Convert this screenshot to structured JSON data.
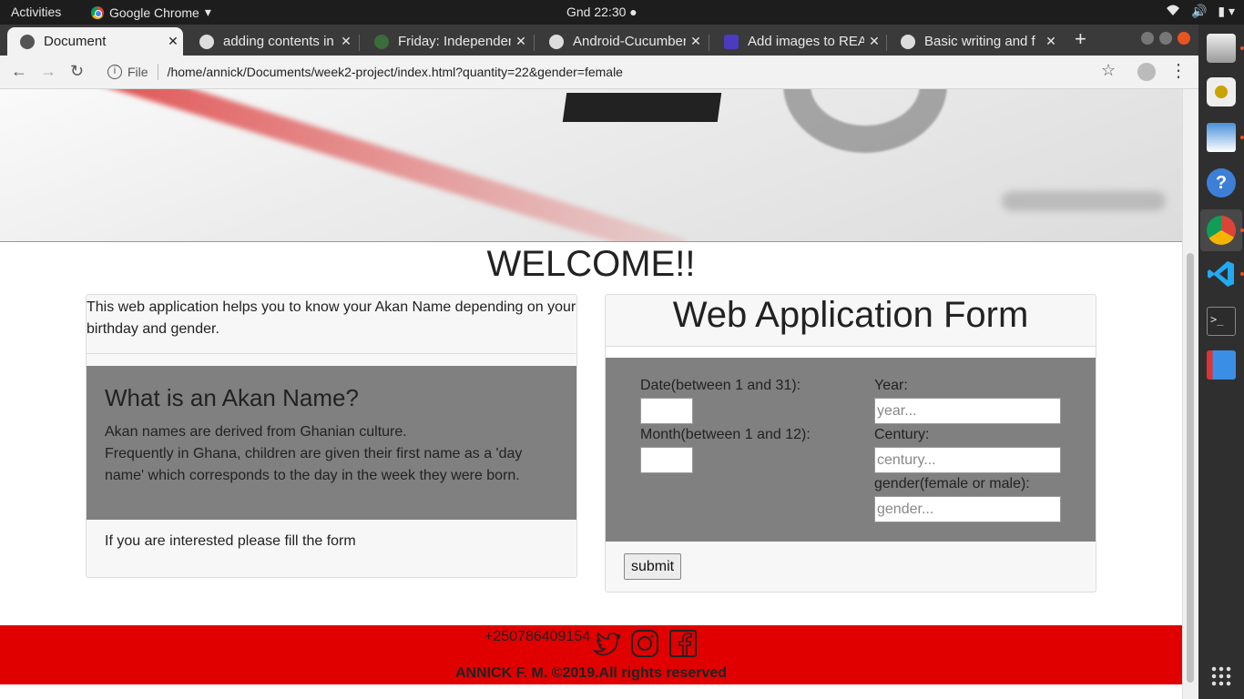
{
  "system_bar": {
    "activities": "Activities",
    "app_name": "Google Chrome",
    "clock": "Gnd 22:30"
  },
  "browser": {
    "tabs": [
      {
        "title": "Document",
        "active": true
      },
      {
        "title": "adding contents in",
        "active": false
      },
      {
        "title": "Friday: Independen",
        "active": false
      },
      {
        "title": "Android-Cucumber",
        "active": false
      },
      {
        "title": "Add images to REA",
        "active": false
      },
      {
        "title": "Basic writing and f",
        "active": false
      }
    ],
    "address_prefix": "File",
    "url": "/home/annick/Documents/week2-project/index.html?quantity=22&gender=female"
  },
  "page": {
    "welcome": "WELCOME!!",
    "intro": "This web application helps you to know your Akan Name depending on your birthday and gender.",
    "akan_heading": "What is an Akan Name?",
    "akan_text_1": "Akan names are derived from Ghanian culture.",
    "akan_text_2": "Frequently in Ghana, children are given their first name as a 'day name' which corresponds to the day in the week they were born.",
    "interest_text": "If you are interested please fill the form",
    "form": {
      "title": "Web Application Form",
      "date_label": "Date(between 1 and 31):",
      "month_label": "Month(between 1 and 12):",
      "year_label": "Year:",
      "year_placeholder": "year...",
      "century_label": "Century:",
      "century_placeholder": "century...",
      "gender_label": "gender(female or male):",
      "gender_placeholder": "gender...",
      "submit_label": "submit"
    },
    "footer": {
      "phone": "+250786409154",
      "copyright": "ANNICK F. M. ©2019.All rights reserved"
    }
  }
}
